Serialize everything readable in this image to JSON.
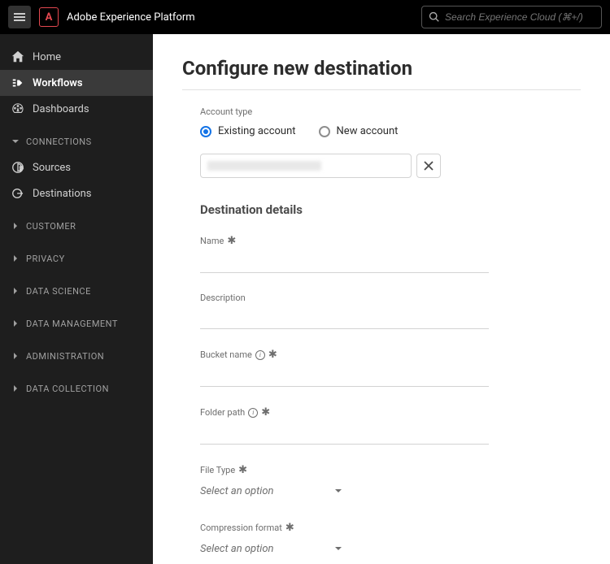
{
  "header": {
    "app_title": "Adobe Experience Platform",
    "search_placeholder": "Search Experience Cloud (⌘+/)"
  },
  "sidebar": {
    "top": [
      {
        "label": "Home",
        "icon": "home"
      },
      {
        "label": "Workflows",
        "icon": "workflow",
        "active": true
      },
      {
        "label": "Dashboards",
        "icon": "dashboard"
      }
    ],
    "sections": [
      {
        "label": "CONNECTIONS",
        "expanded": true,
        "items": [
          {
            "label": "Sources",
            "icon": "sources"
          },
          {
            "label": "Destinations",
            "icon": "destinations"
          }
        ]
      },
      {
        "label": "CUSTOMER",
        "expanded": false
      },
      {
        "label": "PRIVACY",
        "expanded": false
      },
      {
        "label": "DATA SCIENCE",
        "expanded": false
      },
      {
        "label": "DATA MANAGEMENT",
        "expanded": false
      },
      {
        "label": "ADMINISTRATION",
        "expanded": false
      },
      {
        "label": "DATA COLLECTION",
        "expanded": false
      }
    ]
  },
  "main": {
    "title": "Configure new destination",
    "account_type_label": "Account type",
    "radio_existing": "Existing account",
    "radio_new": "New account",
    "details_title": "Destination details",
    "fields": {
      "name_label": "Name",
      "description_label": "Description",
      "bucket_label": "Bucket name",
      "folder_label": "Folder path",
      "filetype_label": "File Type",
      "compression_label": "Compression format",
      "select_placeholder": "Select an option"
    }
  }
}
